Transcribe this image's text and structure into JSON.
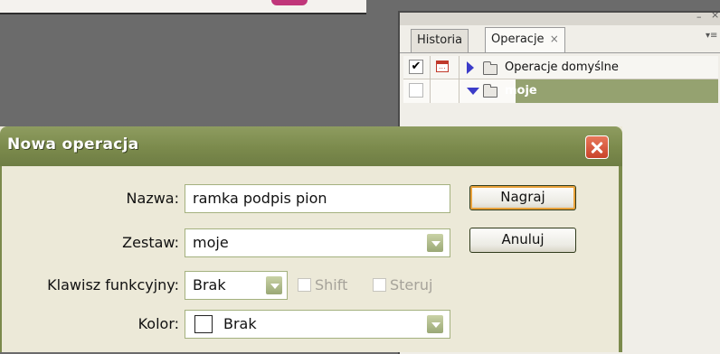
{
  "actions_panel": {
    "tabs": [
      {
        "label": "Historia"
      },
      {
        "label": "Operacje",
        "close": "×"
      }
    ],
    "window_controls": {
      "minimize": "–",
      "close": "×",
      "menu": "▾≡"
    },
    "rows": [
      {
        "label": "Operacje domyślne",
        "checked": true,
        "expanded": false
      },
      {
        "label": "moje",
        "checked": false,
        "expanded": true
      }
    ]
  },
  "dialog": {
    "title": "Nowa operacja",
    "fields": {
      "name_label": "Nazwa:",
      "name_value": "ramka podpis pion",
      "set_label": "Zestaw:",
      "set_value": "moje",
      "fkey_label": "Klawisz funkcyjny:",
      "fkey_value": "Brak",
      "shift_label": "Shift",
      "ctrl_label": "Steruj",
      "color_label": "Kolor:",
      "color_value": "Brak"
    },
    "buttons": {
      "record": "Nagraj",
      "cancel": "Anuluj"
    }
  },
  "colors": {
    "title_bar": "#7b8a4c",
    "selected_row": "#95a270",
    "close_button": "#c9432a",
    "canvas": "#6b6b6b"
  }
}
